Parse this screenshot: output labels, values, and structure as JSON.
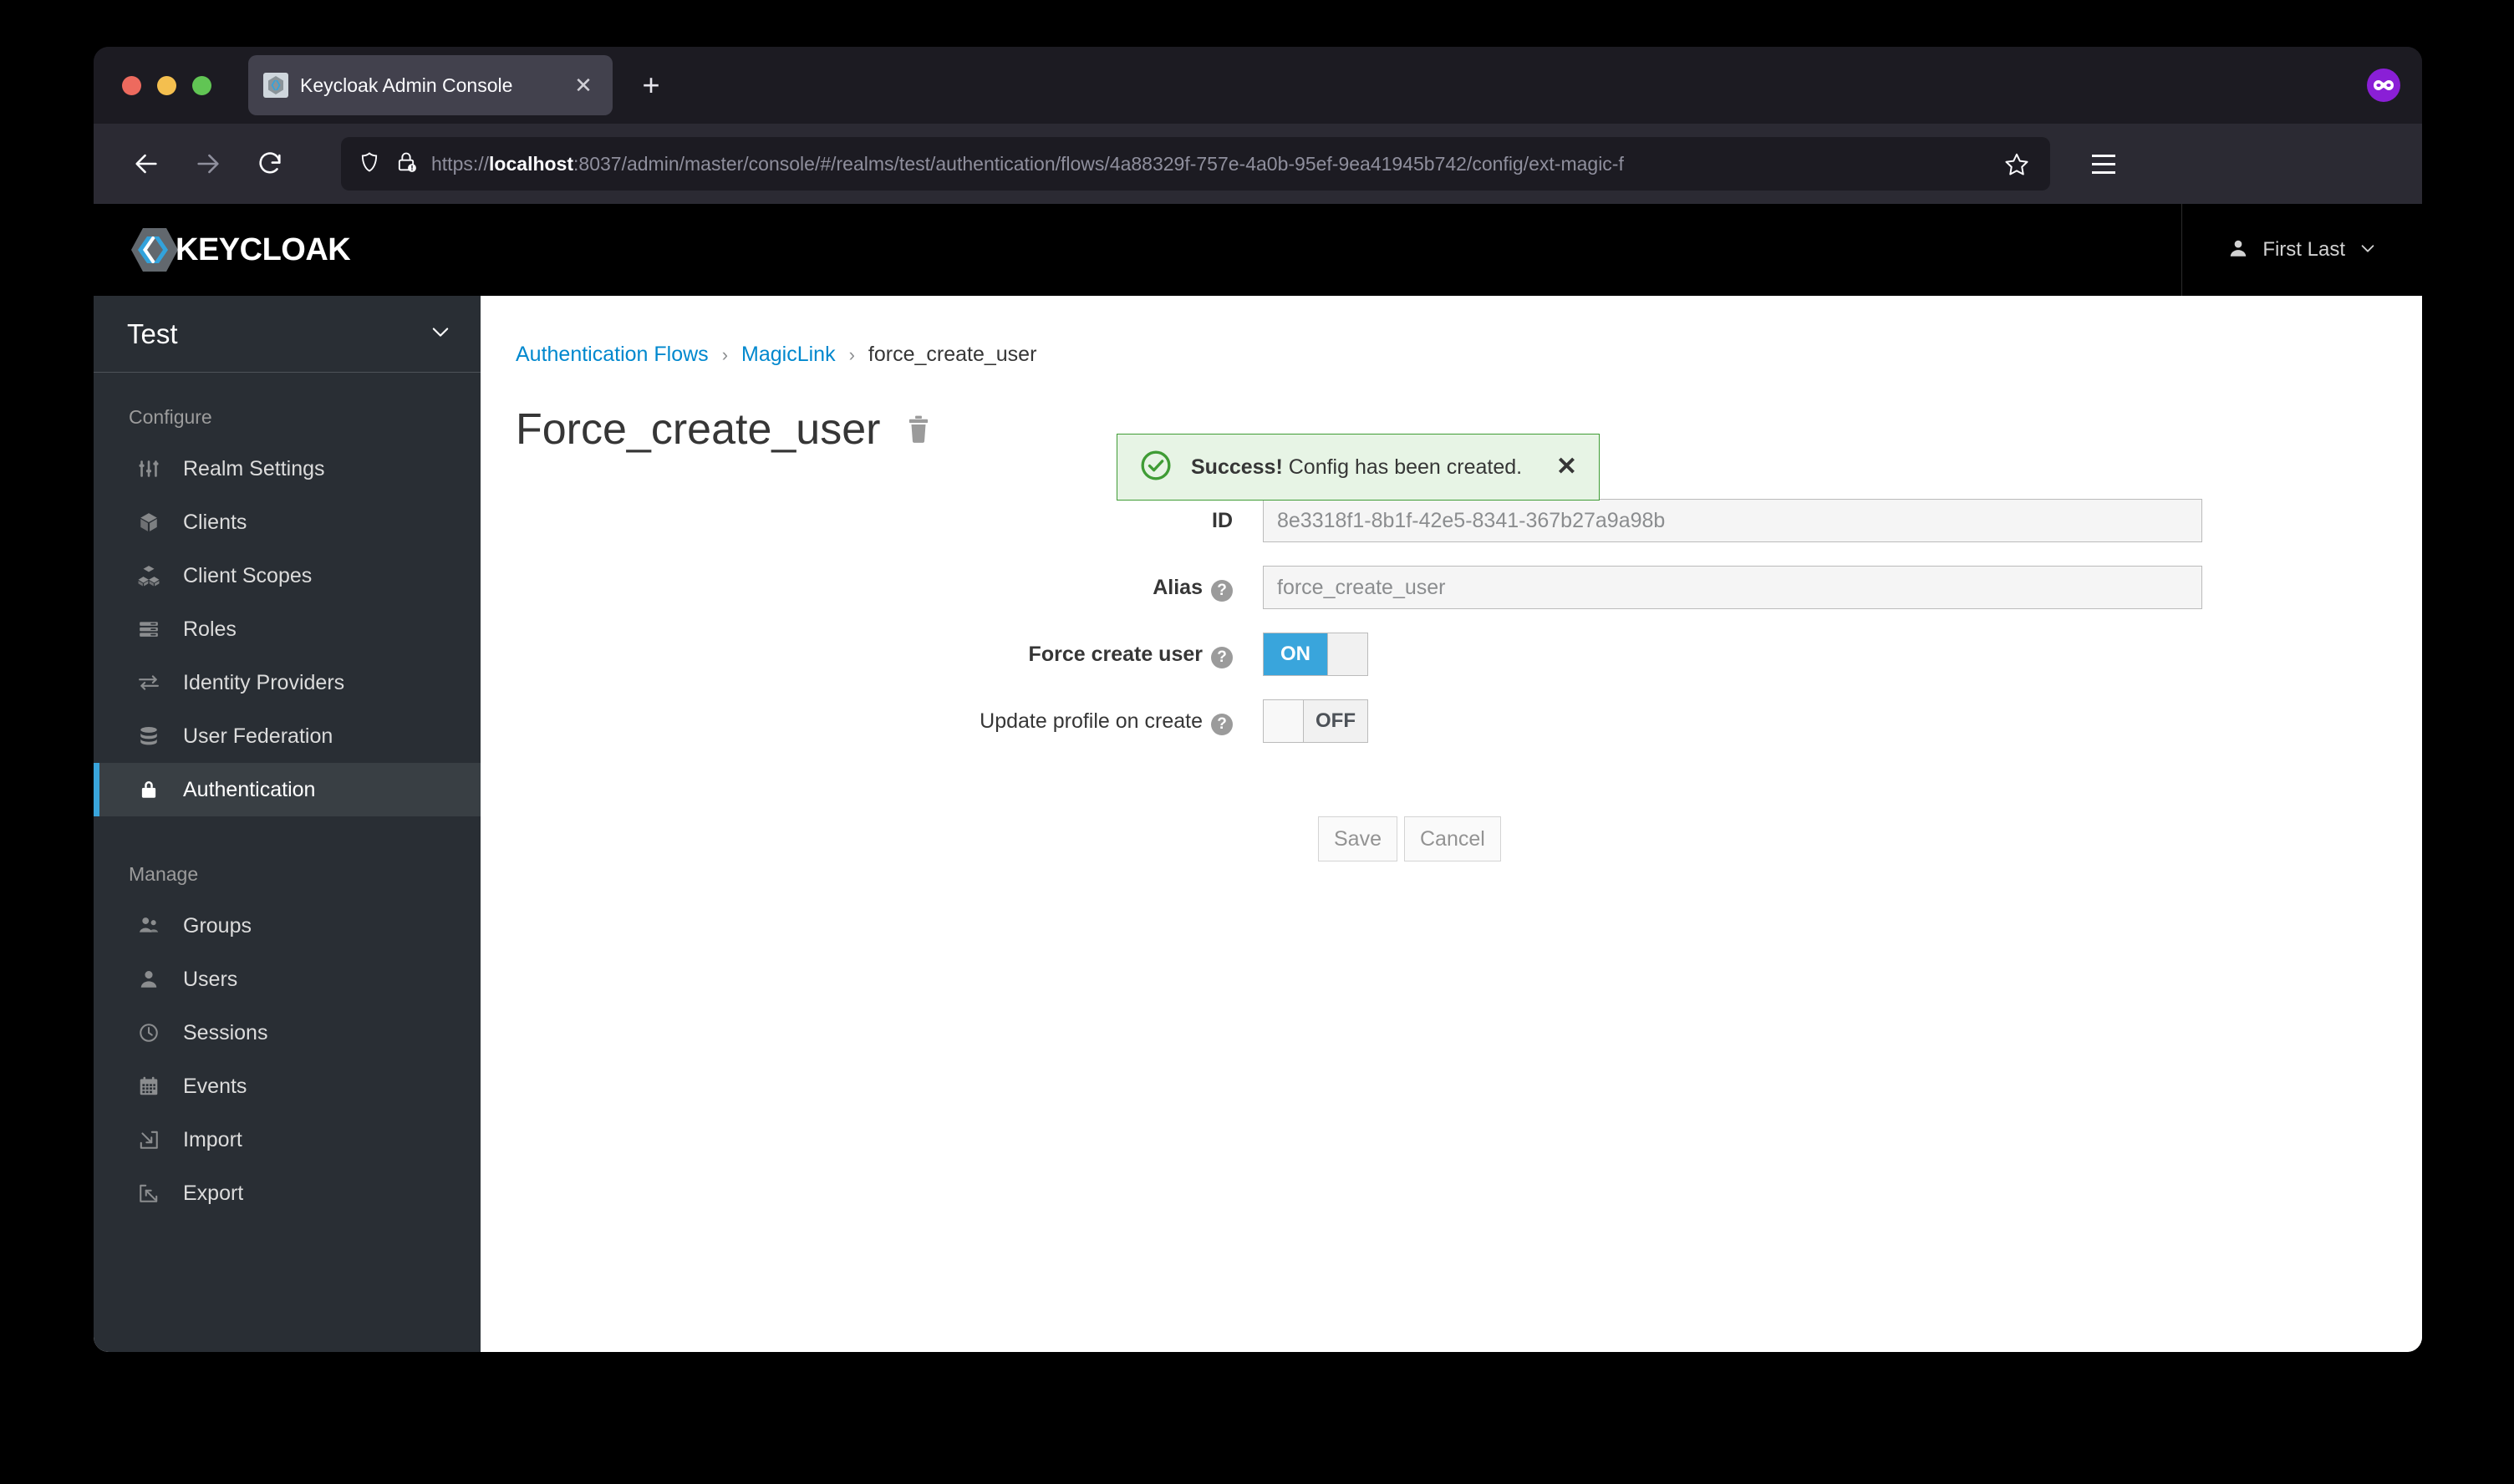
{
  "browser": {
    "tab": {
      "title": "Keycloak Admin Console",
      "favicon": "keycloak-favicon",
      "close_label": "✕"
    },
    "new_tab_label": "+",
    "nav": {
      "back_label": "←",
      "forward_label": "→",
      "reload_label": "⟳"
    },
    "url": {
      "scheme": "https://",
      "host": "localhost",
      "rest": ":8037/admin/master/console/#/realms/test/authentication/flows/4a88329f-757e-4a0b-95ef-9ea41945b742/config/ext-magic-f"
    }
  },
  "masthead": {
    "brand": "KEYCLOAK",
    "user": "First Last",
    "user_caret": "⌄"
  },
  "alert": {
    "strong": "Success!",
    "message": " Config has been created.",
    "close_label": "✕",
    "accent_color": "#3f9c35",
    "background_color": "#e7f4e5"
  },
  "sidebar": {
    "realm": "Test",
    "sections": [
      {
        "title": "Configure",
        "items": [
          {
            "label": "Realm Settings",
            "icon": "sliders-icon",
            "active": false
          },
          {
            "label": "Clients",
            "icon": "cube-icon",
            "active": false
          },
          {
            "label": "Client Scopes",
            "icon": "cubes-icon",
            "active": false
          },
          {
            "label": "Roles",
            "icon": "list-icon",
            "active": false
          },
          {
            "label": "Identity Providers",
            "icon": "exchange-icon",
            "active": false
          },
          {
            "label": "User Federation",
            "icon": "database-icon",
            "active": false
          },
          {
            "label": "Authentication",
            "icon": "lock-icon",
            "active": true
          }
        ]
      },
      {
        "title": "Manage",
        "items": [
          {
            "label": "Groups",
            "icon": "users-icon",
            "active": false
          },
          {
            "label": "Users",
            "icon": "user-icon",
            "active": false
          },
          {
            "label": "Sessions",
            "icon": "clock-icon",
            "active": false
          },
          {
            "label": "Events",
            "icon": "calendar-icon",
            "active": false
          },
          {
            "label": "Import",
            "icon": "import-icon",
            "active": false
          },
          {
            "label": "Export",
            "icon": "export-icon",
            "active": false
          }
        ]
      }
    ],
    "active_accent_color": "#39a5dc"
  },
  "main": {
    "breadcrumb": {
      "items": [
        {
          "label": "Authentication Flows",
          "link": true
        },
        {
          "label": "MagicLink",
          "link": true
        },
        {
          "label": "force_create_user",
          "link": false
        }
      ],
      "separator": "›"
    },
    "page_title": "Force_create_user",
    "delete_icon": "trash-icon",
    "form": {
      "id": {
        "label": "ID",
        "value": "8e3318f1-8b1f-42e5-8341-367b27a9a98b"
      },
      "alias": {
        "label": "Alias",
        "value": "force_create_user",
        "help": "?"
      },
      "force_create_user": {
        "label": "Force create user",
        "state": "ON",
        "help": "?"
      },
      "update_profile_on_create": {
        "label": "Update profile on create",
        "state": "OFF",
        "help": "?"
      },
      "save_label": "Save",
      "cancel_label": "Cancel"
    }
  }
}
